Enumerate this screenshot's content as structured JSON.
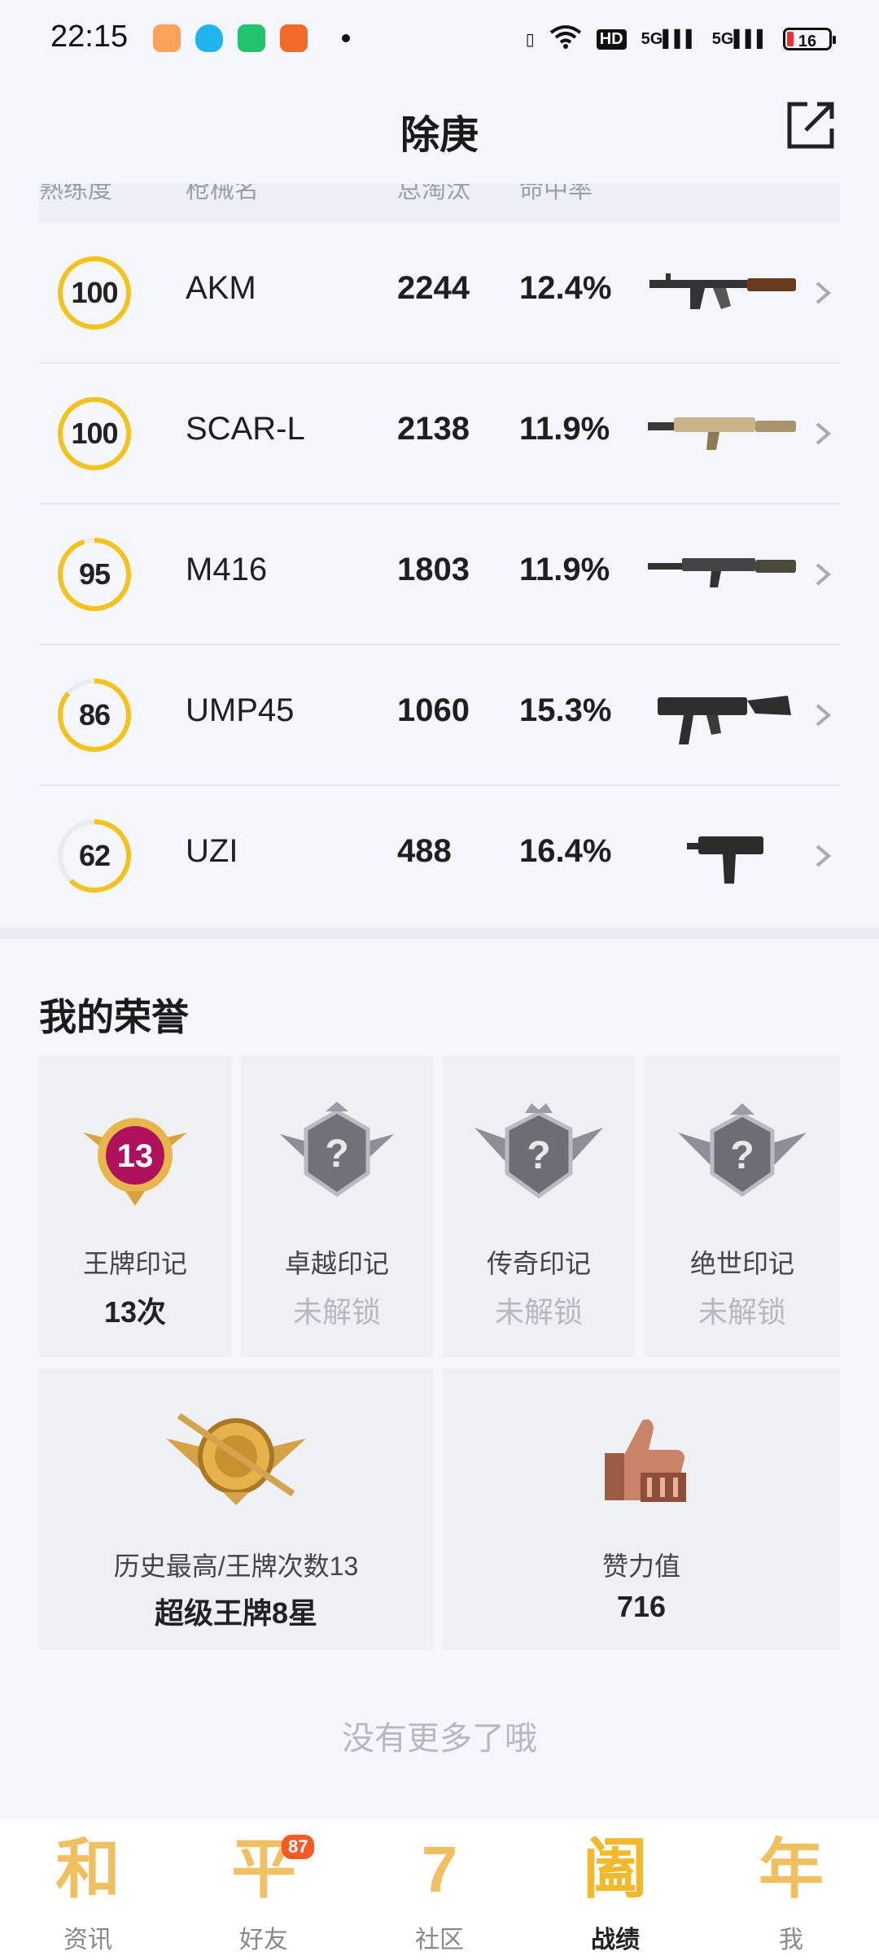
{
  "status_bar": {
    "time": "22:15",
    "net_hd": "HD",
    "sig1": "5G",
    "sig2": "5G",
    "battery": "16"
  },
  "header": {
    "title": "除庚"
  },
  "table": {
    "columns": [
      "熟练度",
      "枪械名",
      "总淘汰",
      "命中率"
    ],
    "rows": [
      {
        "proficiency": "100",
        "name": "AKM",
        "eliminations": "2244",
        "hit_rate": "12.4%",
        "progress": 1.0
      },
      {
        "proficiency": "100",
        "name": "SCAR-L",
        "eliminations": "2138",
        "hit_rate": "11.9%",
        "progress": 1.0
      },
      {
        "proficiency": "95",
        "name": "M416",
        "eliminations": "1803",
        "hit_rate": "11.9%",
        "progress": 0.95
      },
      {
        "proficiency": "86",
        "name": "UMP45",
        "eliminations": "1060",
        "hit_rate": "15.3%",
        "progress": 0.86
      },
      {
        "proficiency": "62",
        "name": "UZI",
        "eliminations": "488",
        "hit_rate": "16.4%",
        "progress": 0.62
      }
    ]
  },
  "honors": {
    "title": "我的荣誉",
    "marks": [
      {
        "label": "王牌印记",
        "value": "13次",
        "badge_num": "13"
      },
      {
        "label": "卓越印记",
        "value": "未解锁",
        "badge_num": "?"
      },
      {
        "label": "传奇印记",
        "value": "未解锁",
        "badge_num": "?"
      },
      {
        "label": "绝世印记",
        "value": "未解锁",
        "badge_num": "?"
      }
    ],
    "history": {
      "label": "历史最高/王牌次数13",
      "value": "超级王牌8星"
    },
    "praise": {
      "label": "赞力值",
      "value": "716"
    },
    "no_more": "没有更多了哦"
  },
  "nav": {
    "items": [
      {
        "glyph": "和",
        "label": "资讯"
      },
      {
        "glyph": "平",
        "label": "好友",
        "badge": "87"
      },
      {
        "glyph": "7",
        "label": "社区"
      },
      {
        "glyph": "阖",
        "label": "战绩"
      },
      {
        "glyph": "年",
        "label": "我"
      }
    ]
  },
  "colors": {
    "ring": "#f3c21b",
    "ring_track": "#e9ebef",
    "accent": "#f0c060"
  }
}
